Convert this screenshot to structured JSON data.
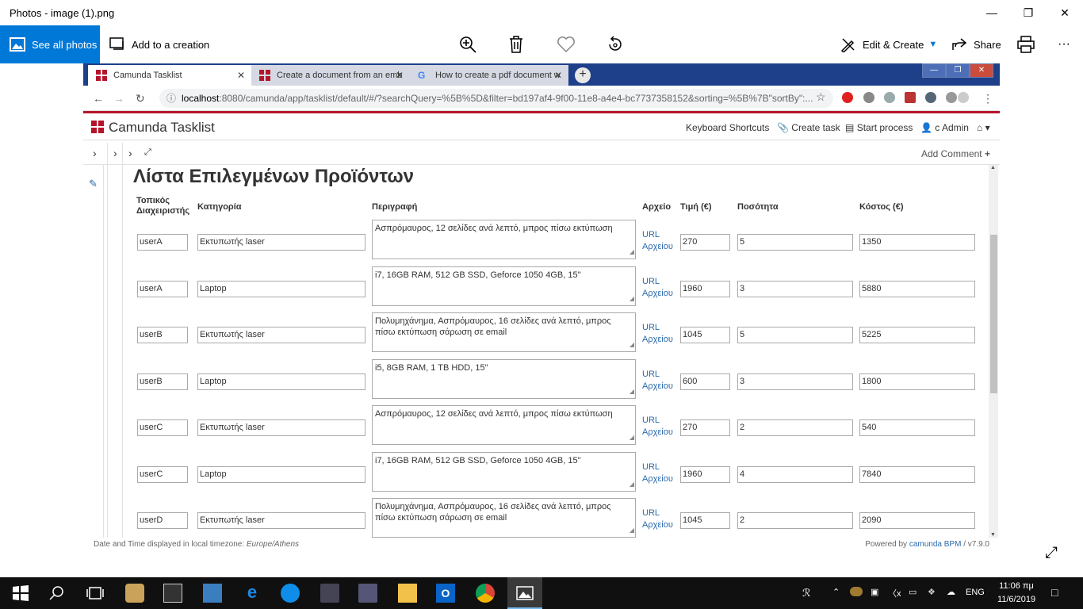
{
  "app": {
    "title": "Photos - image (1).png",
    "see_all": "See all photos",
    "add_creation": "Add to a creation",
    "edit_create": "Edit & Create",
    "share": "Share",
    "more": "···"
  },
  "browser": {
    "tabs": [
      {
        "label": "Camunda Tasklist"
      },
      {
        "label": "Create a document from an emb"
      },
      {
        "label": "How to create a pdf document w"
      }
    ],
    "url_host": "localhost",
    "url_rest": ":8080/camunda/app/tasklist/default/#/?searchQuery=%5B%5D&filter=bd197af4-9f00-11e8-a4e4-bc7737358152&sorting=%5B%7B\"sortBy\":..."
  },
  "camunda": {
    "title": "Camunda Tasklist",
    "shortcuts": "Keyboard Shortcuts",
    "create_task": "Create task",
    "start_process": "Start process",
    "user": "c Admin",
    "add_comment": "Add Comment"
  },
  "form": {
    "title": "Λίστα Επιλεγμένων Προϊόντων",
    "headers": [
      "Τοπικός Διαχειριστής",
      "Κατηγορία",
      "Περιγραφή",
      "Αρχείο",
      "Τιμή (€)",
      "Ποσότητα",
      "Κόστος (€)"
    ],
    "url_label": "URL",
    "file_label": "Αρχείου",
    "rows": [
      {
        "user": "userA",
        "cat": "Εκτυπωτής laser",
        "desc": "Ασπρόμαυρος, 12 σελίδες ανά λεπτό, μπρος πίσω εκτύπωση",
        "price": "270",
        "qty": "5",
        "cost": "1350"
      },
      {
        "user": "userA",
        "cat": "Laptop",
        "desc": "i7, 16GB RAM, 512 GB SSD, Geforce 1050 4GB, 15''",
        "price": "1960",
        "qty": "3",
        "cost": "5880"
      },
      {
        "user": "userB",
        "cat": "Εκτυπωτής laser",
        "desc": "Πολυμηχάνημα, Ασπρόμαυρος, 16 σελίδες ανά λεπτό, μπρος πίσω εκτύπωση σάρωση σε email",
        "price": "1045",
        "qty": "5",
        "cost": "5225"
      },
      {
        "user": "userB",
        "cat": "Laptop",
        "desc": "i5, 8GB RAM, 1 TB HDD, 15''",
        "price": "600",
        "qty": "3",
        "cost": "1800"
      },
      {
        "user": "userC",
        "cat": "Εκτυπωτής laser",
        "desc": "Ασπρόμαυρος, 12 σελίδες ανά λεπτό, μπρος πίσω εκτύπωση",
        "price": "270",
        "qty": "2",
        "cost": "540"
      },
      {
        "user": "userC",
        "cat": "Laptop",
        "desc": "i7, 16GB RAM, 512 GB SSD, Geforce 1050 4GB, 15''",
        "price": "1960",
        "qty": "4",
        "cost": "7840"
      },
      {
        "user": "userD",
        "cat": "Εκτυπωτής laser",
        "desc": "Πολυμηχάνημα, Ασπρόμαυρος, 16 σελίδες ανά λεπτό, μπρος πίσω εκτύπωση σάρωση σε email",
        "price": "1045",
        "qty": "2",
        "cost": "2090"
      }
    ]
  },
  "footer": {
    "tz_label": "Date and Time displayed in local timezone: ",
    "tz": "Europe/Athens",
    "powered": "Powered by ",
    "brand": "camunda BPM",
    "version": " / v7.9.0"
  },
  "taskbar": {
    "time": "11:06 πμ",
    "date": "11/6/2019",
    "lang": "ENG"
  },
  "colors": {
    "accent": "#0078d7",
    "camunda_red": "#b5152b",
    "link": "#2a6aad"
  }
}
